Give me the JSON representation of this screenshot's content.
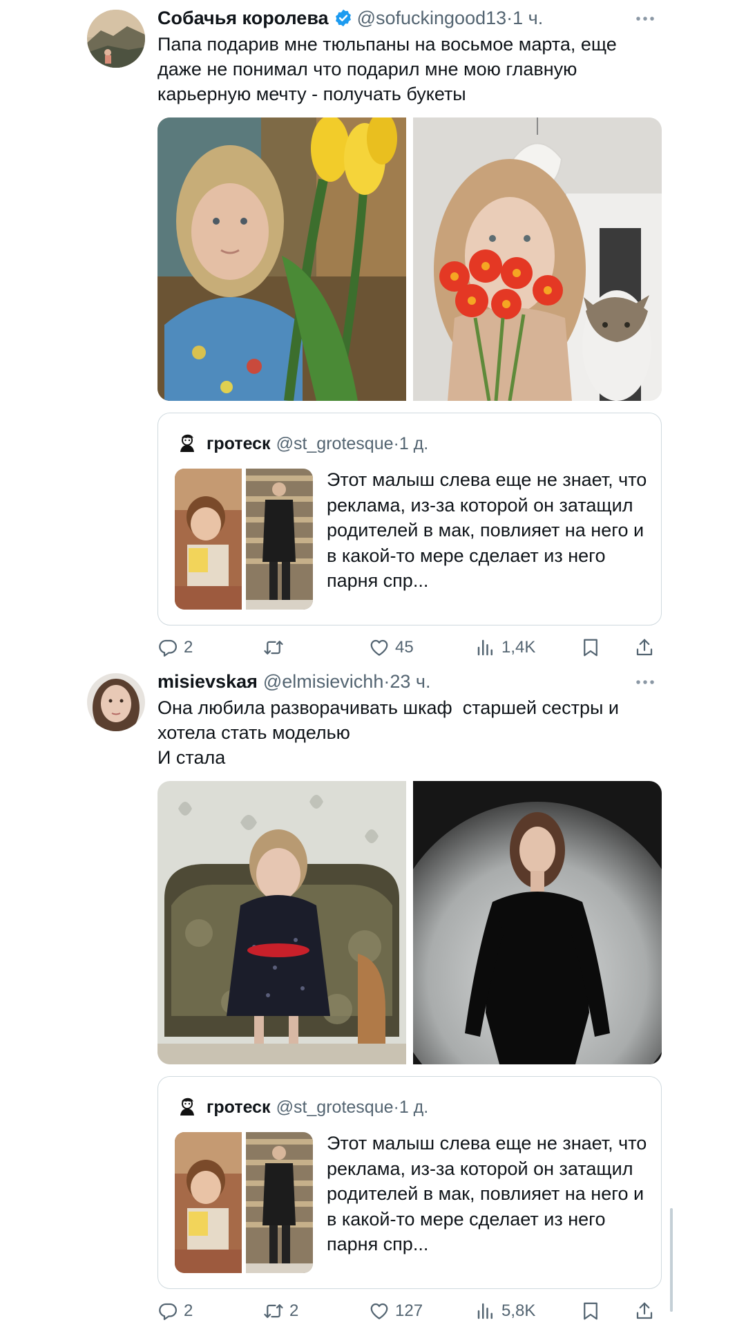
{
  "tweets": [
    {
      "author": "Собачья королева",
      "verified": true,
      "handle": "@sofuckingood13",
      "time": "1 ч.",
      "text": "Папа подарив мне тюльпаны на восьмое марта, еще\nдаже не понимал что подарил мне мою главную\nкарьерную мечту - получать букеты",
      "quote": {
        "author": "гротеск",
        "handle": "@st_grotesque",
        "time": "1 д.",
        "text": "Этот малыш слева  еще не знает, что реклама, из-за которой он затащил родителей в мак, повлияет на него и в какой-то мере сделает из него парня спр..."
      },
      "stats": {
        "replies": "2",
        "retweets": "",
        "likes": "45",
        "views": "1,4K"
      }
    },
    {
      "author": "misievskaя",
      "verified": false,
      "handle": "@elmisievichh",
      "time": "23 ч.",
      "text": "Она любила разворачивать шкаф  старшей сестры и\nхотела стать моделью\nИ стала",
      "quote": {
        "author": "гротеск",
        "handle": "@st_grotesque",
        "time": "1 д.",
        "text": "Этот малыш слева  еще не знает, что реклама, из-за которой он затащил родителей в мак, повлияет на него и в какой-то мере сделает из него парня спр..."
      },
      "stats": {
        "replies": "2",
        "retweets": "2",
        "likes": "127",
        "views": "5,8K"
      }
    }
  ],
  "separator": " · ",
  "colors": {
    "text": "#0f1419",
    "secondary": "#536471",
    "border": "#cfd9de",
    "verified": "#1d9bf0"
  },
  "icons": [
    "verified-icon",
    "more-icon",
    "reply-icon",
    "retweet-icon",
    "like-icon",
    "views-icon",
    "bookmark-icon",
    "share-icon"
  ]
}
